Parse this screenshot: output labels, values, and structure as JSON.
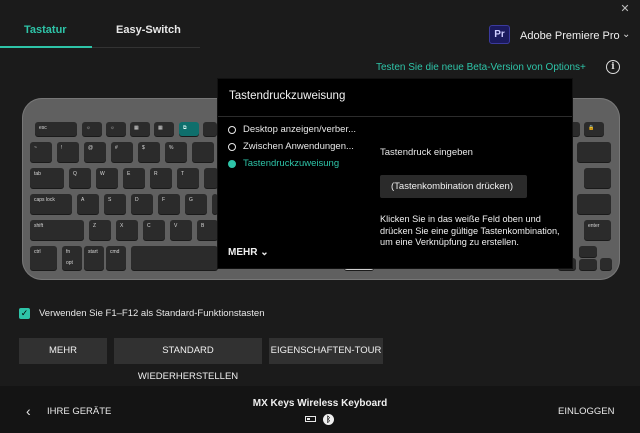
{
  "window": {
    "close_glyph": "✕"
  },
  "tabs": [
    {
      "label": "Tastatur",
      "active": true
    },
    {
      "label": "Easy-Switch",
      "active": false
    }
  ],
  "app_selector": {
    "logo_text": "Pr",
    "name": "Adobe Premiere Pro",
    "chevron": "⌄"
  },
  "beta_link": "Testen Sie die neue Beta-Version von Options+",
  "info_icon": "i",
  "keyboard": {
    "row0": [
      "esc",
      "☼",
      "☼",
      "▦",
      "▦",
      "⧉",
      "",
      "",
      "",
      "",
      "",
      "",
      "",
      "🔒"
    ],
    "row1": [
      "~",
      "!",
      "@",
      "#",
      "$",
      "%",
      "",
      "",
      "",
      "",
      "",
      "",
      "",
      ""
    ],
    "row2": [
      "tab",
      "Q",
      "W",
      "E",
      "R",
      "T",
      "",
      "",
      "",
      "",
      "",
      "",
      "",
      ""
    ],
    "row3": [
      "caps lock",
      "A",
      "S",
      "D",
      "F",
      "G",
      "",
      "",
      "",
      "",
      "",
      "",
      ""
    ],
    "row4": [
      "shift",
      "Z",
      "X",
      "C",
      "V",
      "B",
      "",
      "",
      "",
      "",
      "",
      "",
      "enter"
    ],
    "row5": [
      "ctrl",
      "fn",
      "opt",
      "start",
      "cmd",
      "",
      "",
      "",
      "",
      "",
      "",
      "",
      "",
      ""
    ]
  },
  "popup": {
    "title": "Tastendruckzuweisung",
    "options": [
      {
        "label": "Desktop anzeigen/verber...",
        "selected": false
      },
      {
        "label": "Zwischen Anwendungen...",
        "selected": false
      },
      {
        "label": "Tastendruckzuweisung",
        "selected": true
      }
    ],
    "more_label": "MEHR",
    "more_chevron": "⌄",
    "field_label": "Tastendruck eingeben",
    "field_value": "(Tastenkombination drücken)",
    "help_text": "Klicken Sie in das weiße Feld oben und drücken Sie eine gültige Tastenkombination, um eine Verknüpfung zu erstellen."
  },
  "fkeys": {
    "checked": true,
    "check_glyph": "✓",
    "label": "Verwenden Sie F1–F12 als Standard-Funktionstasten"
  },
  "buttons": {
    "more": "MEHR",
    "restore": "STANDARD WIEDERHERSTELLEN",
    "tour": "EIGENSCHAFTEN-TOUR"
  },
  "footer": {
    "back_glyph": "‹",
    "back_label": "IHRE GERÄTE",
    "device_name": "MX Keys Wireless Keyboard",
    "bt_glyph": "ᛒ",
    "login_label": "EINLOGGEN"
  },
  "colors": {
    "accent": "#2ec4a8",
    "background": "#1b1b1b",
    "popup": "#000000",
    "key_highlight": "#0f6f6c"
  }
}
